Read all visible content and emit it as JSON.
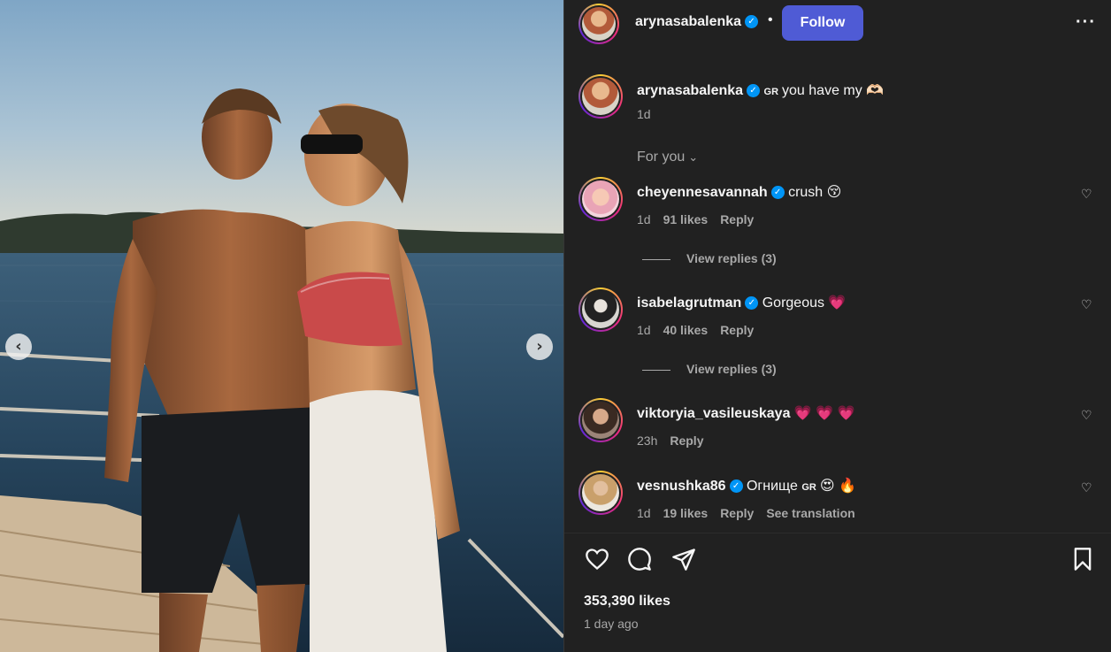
{
  "header": {
    "username": "arynasabalenka",
    "separator": "•",
    "follow_label": "Follow",
    "more_label": "···"
  },
  "caption": {
    "username": "arynasabalenka",
    "badge": "GR",
    "text": "you have my 🫶🏻",
    "time": "1d"
  },
  "filter": {
    "label": "For you",
    "chevron": "⌄"
  },
  "comments": [
    {
      "username": "cheyennesavannah",
      "verified": true,
      "text": "crush 😚",
      "time": "1d",
      "likes": "91 likes",
      "reply_label": "Reply",
      "view_replies": "View replies (3)"
    },
    {
      "username": "isabelagrutman",
      "verified": true,
      "text": "Gorgeous 💗",
      "time": "1d",
      "likes": "40 likes",
      "reply_label": "Reply",
      "view_replies": "View replies (3)"
    },
    {
      "username": "viktoryia_vasileuskaya",
      "verified": false,
      "text": "💗 💗 💗",
      "time": "23h",
      "reply_label": "Reply"
    },
    {
      "username": "vesnushka86",
      "verified": true,
      "text": "Огнище",
      "badge": "GR",
      "emoji": "😍 🔥",
      "time": "1d",
      "likes": "19 likes",
      "reply_label": "Reply",
      "see_translation": "See translation"
    }
  ],
  "footer": {
    "likes": "353,390 likes",
    "time": "1 day ago"
  },
  "icons": {
    "verified": "✓",
    "heart": "♡",
    "prev": "‹",
    "next": "›"
  },
  "colors": {
    "panel_bg": "#212121",
    "follow_bg": "#4f5bd5",
    "verified": "#0095f6",
    "muted_text": "#a8a8a8"
  }
}
